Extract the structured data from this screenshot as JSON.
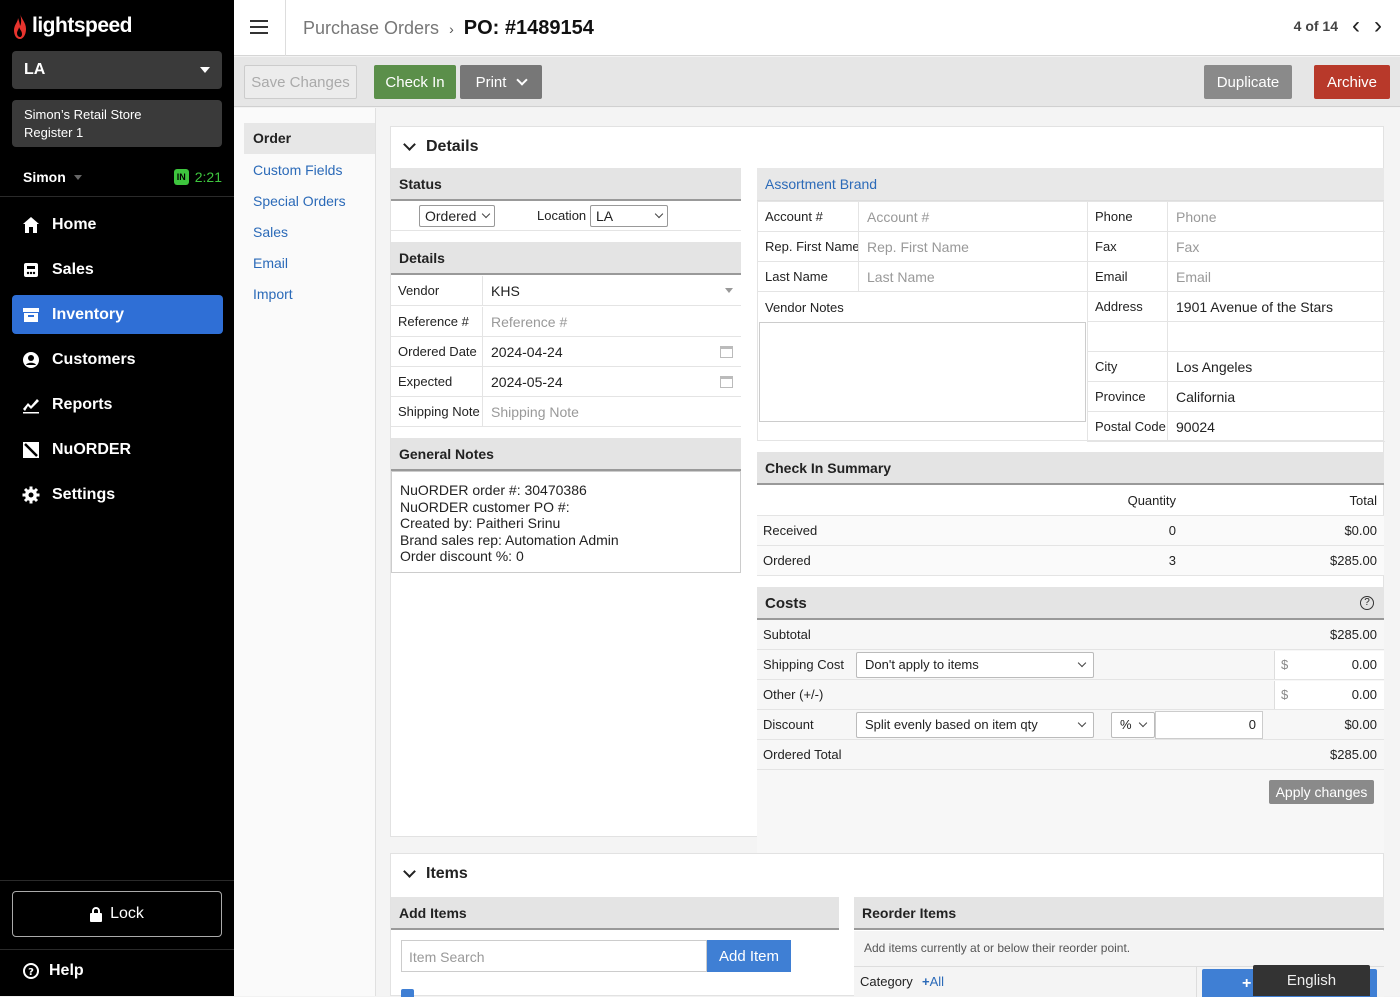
{
  "brand": {
    "name": "lightspeed"
  },
  "sidebar": {
    "location": "LA",
    "store_name": "Simon’s Retail Store",
    "register": "Register 1",
    "user": "Simon",
    "clock_badge": "IN",
    "clock_time": "2:21",
    "nav": [
      {
        "label": "Home",
        "icon": "home-icon"
      },
      {
        "label": "Sales",
        "icon": "sales-icon"
      },
      {
        "label": "Inventory",
        "icon": "inventory-icon",
        "active": true
      },
      {
        "label": "Customers",
        "icon": "customers-icon"
      },
      {
        "label": "Reports",
        "icon": "reports-icon"
      },
      {
        "label": "NuORDER",
        "icon": "nuorder-icon"
      },
      {
        "label": "Settings",
        "icon": "gear-icon"
      }
    ],
    "lock": "Lock",
    "help": "Help"
  },
  "header": {
    "breadcrumb": "Purchase Orders",
    "title": "PO: #1489154",
    "pager": "4 of 14"
  },
  "toolbar": {
    "save": "Save Changes",
    "check_in": "Check In",
    "print": "Print",
    "duplicate": "Duplicate",
    "archive": "Archive"
  },
  "subnav": {
    "active": "Order",
    "items": [
      "Custom Fields",
      "Special Orders",
      "Sales",
      "Email",
      "Import"
    ]
  },
  "details": {
    "section_title": "Details",
    "status_header": "Status",
    "status_value": "Ordered",
    "location_label": "Location",
    "location_value": "LA",
    "details_header": "Details",
    "vendor_label": "Vendor",
    "vendor_value": "KHS",
    "reference_label": "Reference #",
    "reference_placeholder": "Reference #",
    "ordered_date_label": "Ordered Date",
    "ordered_date_value": "2024-04-24",
    "expected_label": "Expected",
    "expected_value": "2024-05-24",
    "shipping_note_label": "Shipping Note",
    "shipping_note_placeholder": "Shipping Note",
    "general_notes_header": "General Notes",
    "general_notes": [
      "NuORDER order #: 30470386",
      "NuORDER customer PO #:",
      "Created by: Paitheri Srinu",
      "Brand sales rep: Automation Admin",
      "Order discount %: 0"
    ]
  },
  "vendor_card": {
    "header": "Assortment Brand",
    "account_label": "Account #",
    "account_placeholder": "Account #",
    "phone_label": "Phone",
    "phone_placeholder": "Phone",
    "rep_first_label": "Rep. First Name",
    "rep_first_placeholder": "Rep. First Name",
    "fax_label": "Fax",
    "fax_placeholder": "Fax",
    "last_name_label": "Last Name",
    "last_name_placeholder": "Last Name",
    "email_label": "Email",
    "email_placeholder": "Email",
    "vendor_notes_label": "Vendor Notes",
    "address_label": "Address",
    "address_value": "1901 Avenue of the Stars",
    "city_label": "City",
    "city_value": "Los Angeles",
    "province_label": "Province",
    "province_value": "California",
    "postal_label": "Postal Code",
    "postal_value": "90024"
  },
  "checkin_summary": {
    "header": "Check In Summary",
    "col_quantity": "Quantity",
    "col_total": "Total",
    "rows": [
      {
        "label": "Received",
        "qty": "0",
        "total": "$0.00"
      },
      {
        "label": "Ordered",
        "qty": "3",
        "total": "$285.00"
      }
    ]
  },
  "costs": {
    "header": "Costs",
    "subtotal_label": "Subtotal",
    "subtotal_value": "$285.00",
    "shipping_label": "Shipping Cost",
    "shipping_option": "Don't apply to items",
    "shipping_currency": "$",
    "shipping_value": "0.00",
    "other_label": "Other (+/-)",
    "other_currency": "$",
    "other_value": "0.00",
    "discount_label": "Discount",
    "discount_option": "Split evenly based on item qty",
    "discount_type": "%",
    "discount_input": "0",
    "discount_value": "$0.00",
    "ordered_total_label": "Ordered Total",
    "ordered_total_value": "$285.00",
    "apply": "Apply changes"
  },
  "items": {
    "section_title": "Items",
    "add_items_header": "Add Items",
    "search_placeholder": "Item Search",
    "add_button": "Add Item",
    "reorder_header": "Reorder Items",
    "reorder_note": "Add items currently at or below their reorder point.",
    "category_label": "Category",
    "category_all": "All"
  },
  "language": "English"
}
